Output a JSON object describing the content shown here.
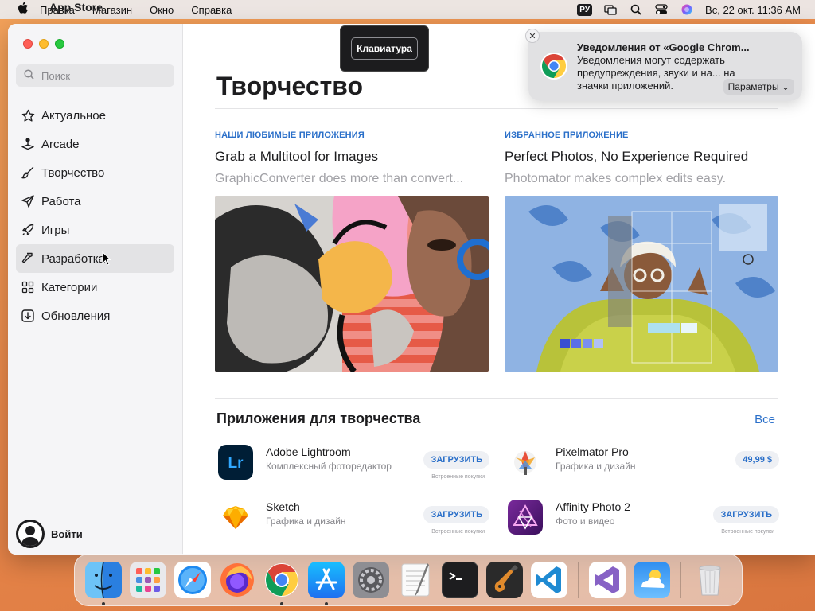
{
  "menubar": {
    "app_name": "App Store",
    "menus": [
      "Правка",
      "Магазин",
      "Окно",
      "Справка"
    ],
    "input_lang": "РУ",
    "datetime": "Вс, 22 окт.  11:36 AM"
  },
  "sidebar": {
    "search_placeholder": "Поиск",
    "items": [
      {
        "label": "Актуальное",
        "icon": "star-icon"
      },
      {
        "label": "Arcade",
        "icon": "joystick-icon"
      },
      {
        "label": "Творчество",
        "icon": "brush-icon"
      },
      {
        "label": "Работа",
        "icon": "paperplane-icon"
      },
      {
        "label": "Игры",
        "icon": "rocket-icon"
      },
      {
        "label": "Разработка",
        "icon": "hammer-icon",
        "active": true
      },
      {
        "label": "Категории",
        "icon": "grid-icon"
      },
      {
        "label": "Обновления",
        "icon": "download-icon"
      }
    ],
    "signin": "Войти"
  },
  "main": {
    "title": "Творчество",
    "features": [
      {
        "eyebrow": "НАШИ ЛЮБИМЫЕ ПРИЛОЖЕНИЯ",
        "title": "Grab a Multitool for Images",
        "subtitle": "GraphicConverter does more than convert..."
      },
      {
        "eyebrow": "ИЗБРАННОЕ ПРИЛОЖЕНИЕ",
        "title": "Perfect Photos, No Experience Required",
        "subtitle": "Photomator makes complex edits easy."
      }
    ],
    "section_title": "Приложения для творчества",
    "see_all": "Все",
    "apps": [
      {
        "name": "Adobe Lightroom",
        "category": "Комплексный фоторедактор",
        "button": "ЗАГРУЗИТЬ",
        "iap": "Встроенные покупки"
      },
      {
        "name": "Pixelmator Pro",
        "category": "Графика и дизайн",
        "button": "49,99 $",
        "iap": ""
      },
      {
        "name": "Sketch",
        "category": "Графика и дизайн",
        "button": "ЗАГРУЗИТЬ",
        "iap": "Встроенные покупки"
      },
      {
        "name": "Affinity Photo 2",
        "category": "Фото и видео",
        "button": "ЗАГРУЗИТЬ",
        "iap": "Встроенные покупки"
      }
    ]
  },
  "keyboard_overlay": {
    "label": "Клавиатура"
  },
  "notification": {
    "title": "Уведомления от «Google Chrom...",
    "body": "Уведомления могут содержать предупреждения, звуки и на... на значки приложений.",
    "button": "Параметры ⌄"
  },
  "dock": {
    "apps": [
      "finder-icon",
      "launchpad-icon",
      "safari-icon",
      "firefox-icon",
      "chrome-icon",
      "appstore-icon",
      "system-settings-icon",
      "textedit-icon",
      "terminal-icon",
      "garageband-icon",
      "vscode-icon",
      "visual-studio-icon",
      "weather-icon",
      "trash-icon"
    ]
  },
  "colors": {
    "accent": "#2a6fc9",
    "wallpaper": "#e8874a"
  }
}
